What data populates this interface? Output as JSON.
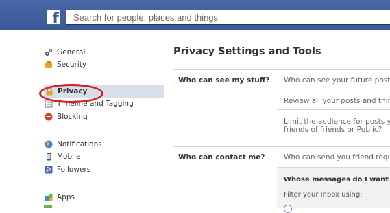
{
  "topbar": {
    "logo": "f",
    "search_placeholder": "Search for people, places and things"
  },
  "sidebar": {
    "items": [
      {
        "label": "General",
        "icon": "gears-icon"
      },
      {
        "label": "Security",
        "icon": "badge-icon"
      },
      {
        "label": "Privacy",
        "icon": "lock-icon"
      },
      {
        "label": "Timeline and Tagging",
        "icon": "timeline-icon"
      },
      {
        "label": "Blocking",
        "icon": "block-icon"
      },
      {
        "label": "Notifications",
        "icon": "globe-icon"
      },
      {
        "label": "Mobile",
        "icon": "phone-icon"
      },
      {
        "label": "Followers",
        "icon": "rss-icon"
      },
      {
        "label": "Apps",
        "icon": "apps-icon"
      }
    ]
  },
  "main": {
    "title": "Privacy Settings and Tools",
    "sections": [
      {
        "label": "Who can see my stuff?",
        "options": [
          "Who can see your future posts?",
          "Review all your posts and things",
          "Limit the audience for posts you",
          "friends of friends or Public?"
        ]
      },
      {
        "label": "Who can contact me?",
        "options": [
          "Who can send you friend reques"
        ]
      }
    ],
    "messages_box": {
      "title": "Whose messages do I want filt",
      "text": "Filter your Inbox using:"
    }
  },
  "colors": {
    "topbar": "#3b5998",
    "active_item": "#d8dfea",
    "annotation_circle": "#d61f26"
  }
}
